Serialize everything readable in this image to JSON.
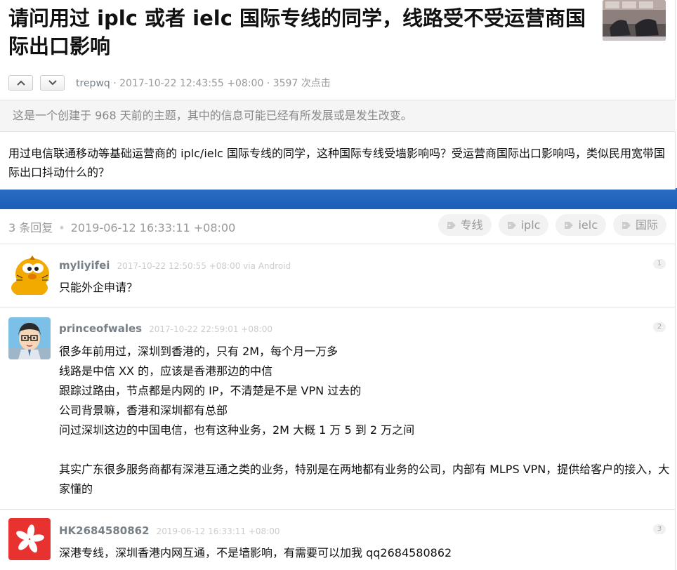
{
  "topic": {
    "title_parts": [
      {
        "text": "请问用过 ",
        "bold": false
      },
      {
        "text": "iplc",
        "bold": true
      },
      {
        "text": " 或者 ",
        "bold": false
      },
      {
        "text": "ielc",
        "bold": true
      },
      {
        "text": " 国际专线的同学，线路受不受运营商国际出口影响",
        "bold": false
      }
    ],
    "author": "trepwq",
    "meta": " · 2017-10-22 12:43:55 +08:00 · 3597 次点击",
    "notice": "这是一个创建于 968 天前的主题，其中的信息可能已经有所发展或是发生改变。",
    "content": "用过电信联通移动等基础运营商的 iplc/ielc 国际专线的同学，这种国际专线受墙影响吗？受运营商国际出口影响吗，类似民用宽带国际出口抖动什么的？"
  },
  "replies_header": {
    "count": "3 条回复",
    "time": "2019-06-12 16:33:11 +08:00",
    "tags": [
      "专线",
      "iplc",
      "ielc",
      "国际"
    ]
  },
  "replies": [
    {
      "user": "myliyifei",
      "time": "2017-10-22 12:50:55 +08:00 via Android",
      "num": "1",
      "lines": [
        "只能外企申请？"
      ]
    },
    {
      "user": "princeofwales",
      "time": "2017-10-22 22:59:01 +08:00",
      "num": "2",
      "lines": [
        "很多年前用过，深圳到香港的，只有 2M，每个月一万多",
        "线路是中信 XX 的，应该是香港那边的中信",
        "跟踪过路由，节点都是内网的 IP，不清楚是不是 VPN 过去的",
        "公司背景嘛，香港和深圳都有总部",
        "问过深圳这边的中国电信，也有这种业务，2M 大概 1 万 5 到 2 万之间",
        "",
        "其实广东很多服务商都有深港互通之类的业务，特别是在两地都有业务的公司，内部有 MLPS VPN，提供给客户的接入，大家懂的"
      ]
    },
    {
      "user": "HK2684580862",
      "time": "2019-06-12 16:33:11 +08:00",
      "num": "3",
      "lines": [
        "深港专线，深圳香港内网互通，不是墙影响，有需要可以加我 qq2684580862"
      ]
    }
  ],
  "icons": {
    "vote_up": "chevron-up-icon",
    "vote_down": "chevron-down-icon",
    "tag": "tag-icon"
  },
  "colors": {
    "accent_blue": "#1b5fb8",
    "meta_gray": "#999999",
    "username": "#778087"
  }
}
